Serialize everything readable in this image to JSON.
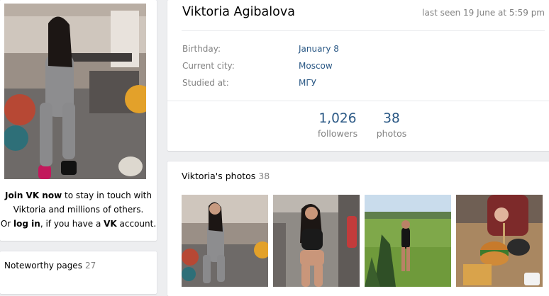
{
  "profile": {
    "name": "Viktoria Agibalova",
    "last_seen": "last seen 19 June at 5:59 pm",
    "info": [
      {
        "label": "Birthday:",
        "value": "January 8"
      },
      {
        "label": "Current city:",
        "value": "Moscow"
      },
      {
        "label": "Studied at:",
        "value": "МГУ"
      }
    ],
    "counters": [
      {
        "number": "1,026",
        "label": "followers"
      },
      {
        "number": "38",
        "label": "photos"
      }
    ]
  },
  "join": {
    "part1": "Join VK now",
    "part2": " to stay in touch with Viktoria and millions of others.",
    "part3": "Or ",
    "login": "log in",
    "part4": ", if you have a ",
    "vk": "VK",
    "part5": " account."
  },
  "noteworthy": {
    "label": "Noteworthy pages",
    "count": "27"
  },
  "photos": {
    "title": "Viktoria's photos",
    "count": "38"
  },
  "colors": {
    "link": "#2a5885",
    "muted": "#828282",
    "background": "#edeef0"
  }
}
